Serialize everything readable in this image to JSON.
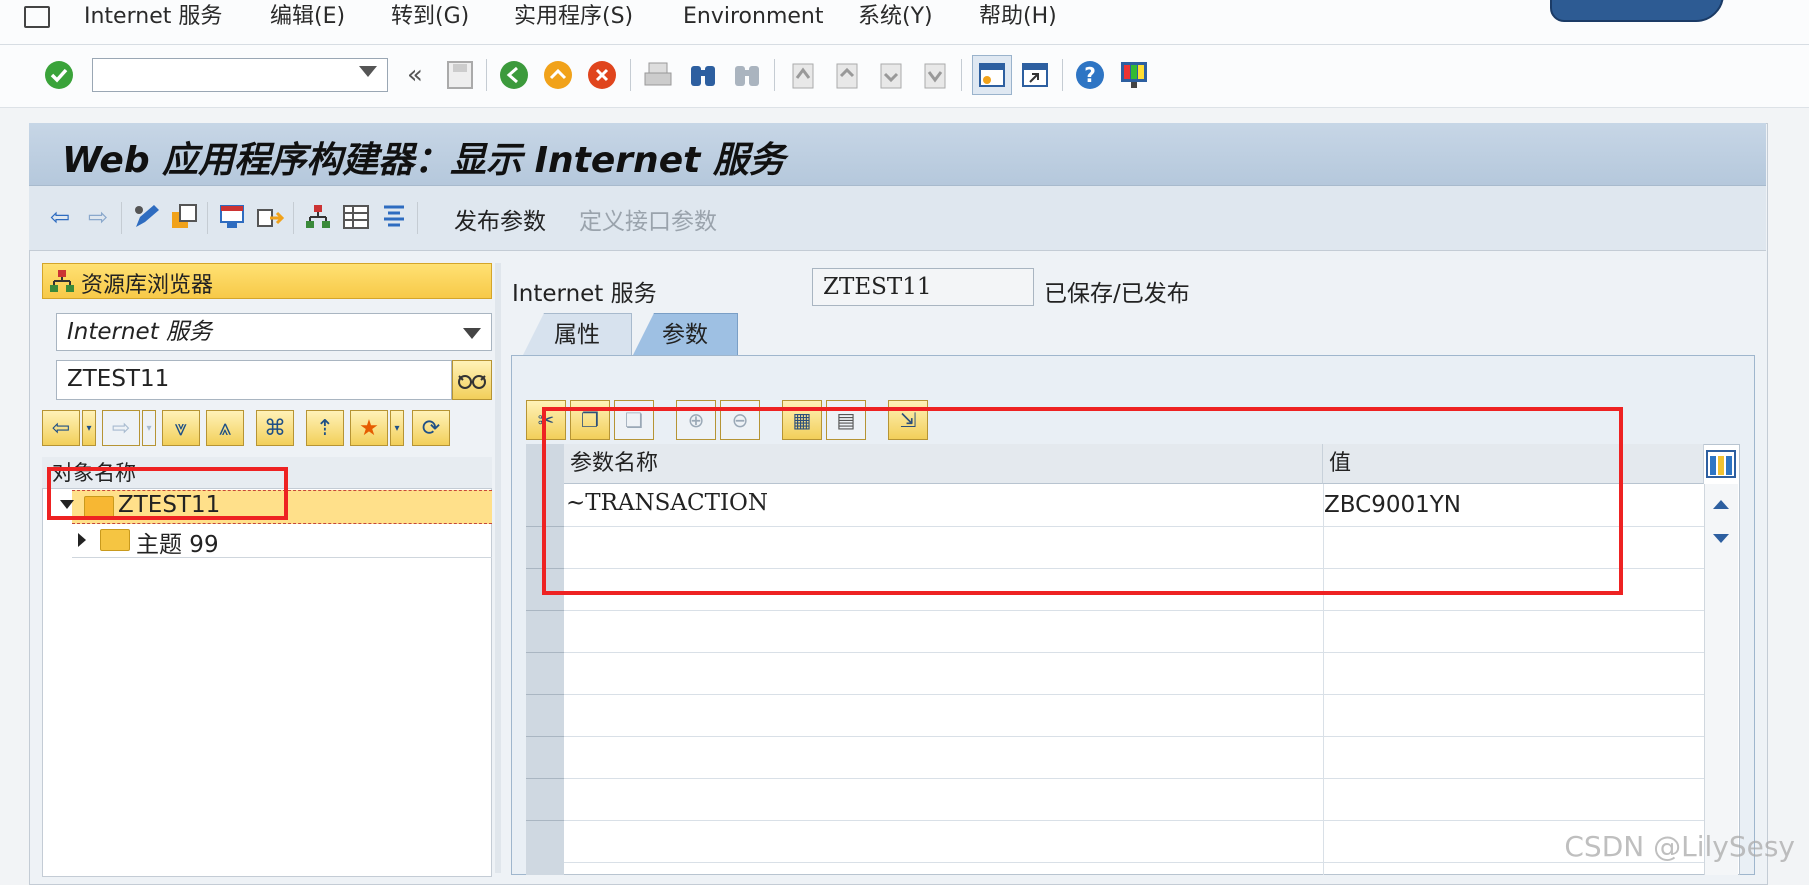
{
  "menu": {
    "items": [
      "Internet 服务",
      "编辑(E)",
      "转到(G)",
      "实用程序(S)",
      "Environment",
      "系统(Y)",
      "帮助(H)"
    ]
  },
  "toolbar": {
    "command_field_value": "",
    "icons": [
      "enter-check-icon",
      "back-double-icon",
      "save-icon",
      "back-icon",
      "exit-icon",
      "cancel-icon",
      "print-icon",
      "find-icon",
      "find-next-icon",
      "first-page-icon",
      "prev-page-icon",
      "next-page-icon",
      "last-page-icon",
      "new-session-icon",
      "shortcut-icon",
      "help-icon",
      "customize-layout-icon"
    ]
  },
  "title": "Web 应用程序构建器：显示 Internet 服务",
  "app_toolbar": {
    "publish_params_label": "发布参数",
    "define_interface_params_label": "定义接口参数"
  },
  "navigator": {
    "header": "资源库浏览器",
    "object_type": "Internet 服务",
    "object_name": "ZTEST11",
    "tree_column_header": "对象名称",
    "nodes": [
      {
        "label": "ZTEST11",
        "expanded": true
      },
      {
        "label": "主题 99",
        "expanded": false
      }
    ]
  },
  "service": {
    "label": "Internet 服务",
    "name": "ZTEST11",
    "status": "已保存/已发布"
  },
  "tabs": {
    "attributes": "属性",
    "parameters": "参数",
    "active": "参数"
  },
  "param_grid": {
    "columns": [
      "参数名称",
      "值"
    ],
    "rows": [
      {
        "name": "~TRANSACTION",
        "value": "ZBC9001YN"
      }
    ]
  },
  "watermark": "CSDN @LilySesy",
  "colors": {
    "highlight_red": "#ee2222",
    "title_blue": "#b5c8dc",
    "selection_yellow": "#ffe08a"
  }
}
